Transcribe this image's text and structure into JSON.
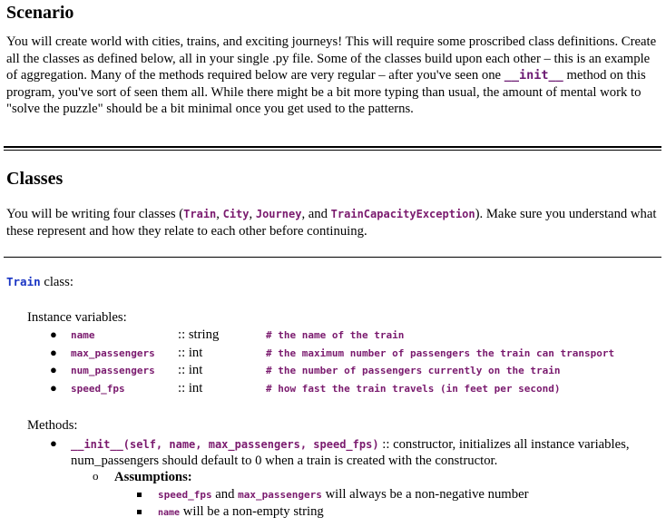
{
  "scenario": {
    "heading": "Scenario",
    "paragraph": {
      "before_init": "You will create world with cities, trains, and exciting journeys! This will require some proscribed class definitions. Create all the classes as defined below, all in your single .py file. Some of the classes build upon each other – this is an example of aggregation. Many of the methods required below are very regular – after you've seen one ",
      "init_code": "__init__",
      "after_init": " method on this program, you've sort of seen them all. While there might be a bit more typing than usual, the amount of mental work to \"solve the puzzle\" should be a bit minimal once you get used to the patterns."
    }
  },
  "classes": {
    "heading": "Classes",
    "intro": {
      "prefix": "You will be writing four classes (",
      "class_names": [
        "Train",
        "City",
        "Journey",
        "TrainCapacityException"
      ],
      "sep1": ", ",
      "sep2": ", ",
      "sep3": ", and ",
      "suffix": "). Make sure you understand what these represent and how they relate to each other before continuing."
    }
  },
  "train_class": {
    "name_code": "Train",
    "label": " class:",
    "instance_variables_label": "Instance variables:",
    "instance_variables": [
      {
        "name": "name",
        "type": ":: string",
        "comment": "# the name of the train"
      },
      {
        "name": "max_passengers",
        "type": ":: int",
        "comment": "# the maximum number of passengers the train can transport"
      },
      {
        "name": "num_passengers",
        "type": ":: int",
        "comment": "# the number of passengers currently on the train"
      },
      {
        "name": "speed_fps",
        "type": ":: int",
        "comment": "# how fast the train travels (in feet per second)"
      }
    ],
    "methods_label": "Methods:",
    "methods": [
      {
        "signature": "__init__(self, name, max_passengers, speed_fps)",
        "desc_line1": " :: constructor, initializes all instance variables,",
        "desc_line2": "num_passengers should default to 0 when a train is created with the constructor.",
        "assumptions_label": "Assumptions:",
        "assumptions": [
          {
            "code1": "speed_fps",
            "text1": " and ",
            "code2": "max_passengers",
            "text2": " will always be a non-negative number"
          },
          {
            "code1": "name",
            "text1": " will be a non-empty string"
          }
        ]
      }
    ]
  }
}
